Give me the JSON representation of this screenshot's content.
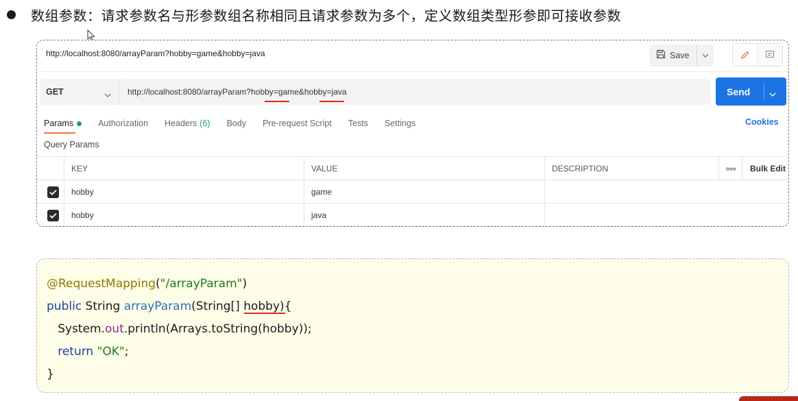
{
  "heading": {
    "text": "数组参数：请求参数名与形参数组名称相同且请求参数为多个，定义数组类型形参即可接收参数"
  },
  "postman": {
    "title_url": "http://localhost:8080/arrayParam?hobby=game&hobby=java",
    "save_label": "Save",
    "method": "GET",
    "url": {
      "base": "http://localhost:8080/arrayParam?",
      "key1": "hobby",
      "mid": "=game&",
      "key2": "hobby",
      "tail": "=java"
    },
    "send_label": "Send",
    "tabs": {
      "params": "Params",
      "authorization": "Authorization",
      "headers": "Headers",
      "headers_count": "(6)",
      "body": "Body",
      "prerequest": "Pre-request Script",
      "tests": "Tests",
      "settings": "Settings"
    },
    "cookies_label": "Cookies",
    "query_params_title": "Query Params",
    "table": {
      "headers": {
        "key": "KEY",
        "value": "VALUE",
        "description": "DESCRIPTION",
        "more": "ooo",
        "bulk": "Bulk Edit"
      },
      "rows": [
        {
          "key": "hobby",
          "value": "game",
          "description": ""
        },
        {
          "key": "hobby",
          "value": "java",
          "description": ""
        }
      ]
    }
  },
  "code": {
    "line1_ann": "@RequestMapping",
    "line1_open": "(",
    "line1_str": "\"/arrayParam\"",
    "line1_close": ")",
    "line2_kw": "public",
    "line2_type": " String ",
    "line2_fn": "arrayParam",
    "line2_param_open": "(String[] ",
    "line2_param": "hobby",
    "line2_close": "){",
    "line3_a": "   System.",
    "line3_field": "out",
    "line3_b": ".println(Arrays.toString(hobby));",
    "line4_indent": "   ",
    "line4_kw": "return",
    "line4_space": " ",
    "line4_str": "\"OK\"",
    "line4_semi": ";",
    "line5": "}"
  },
  "colors": {
    "send_blue": "#1b74e4",
    "active_tab_orange": "#ff6c37",
    "params_dot_green": "#1aa35a",
    "underline_red": "#e0291f",
    "code_bg": "#fefde8"
  }
}
